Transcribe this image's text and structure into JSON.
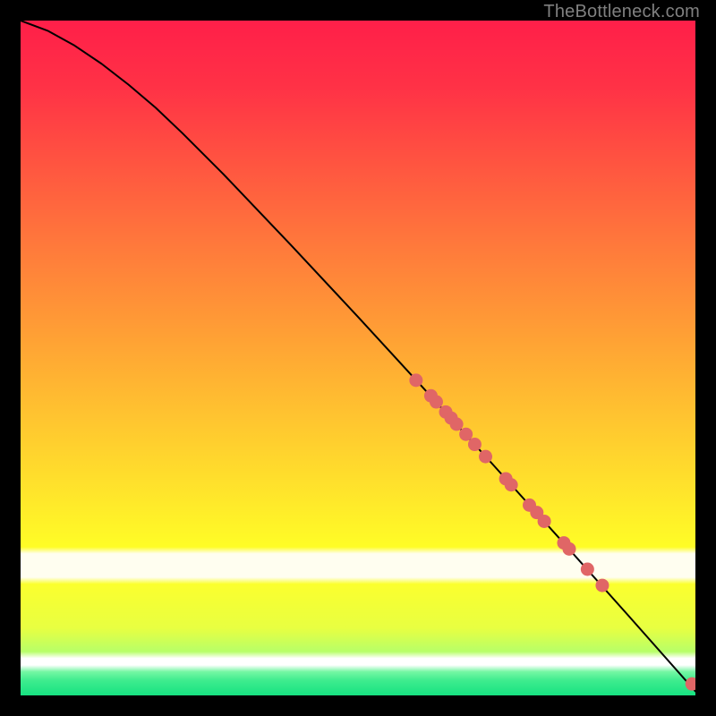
{
  "watermark": {
    "text": "TheBottleneck.com"
  },
  "chart_data": {
    "type": "line",
    "title": "",
    "xlabel": "",
    "ylabel": "",
    "xlim": [
      0,
      100
    ],
    "ylim": [
      0,
      100
    ],
    "series": [
      {
        "name": "curve",
        "x": [
          0,
          4,
          8,
          12,
          16,
          20,
          24,
          30,
          40,
          50,
          60,
          70,
          80,
          90,
          100
        ],
        "y": [
          100,
          98.5,
          96.3,
          93.6,
          90.5,
          87.1,
          83.3,
          77.3,
          66.8,
          56.1,
          45.2,
          34.2,
          23.1,
          11.9,
          0.6
        ]
      },
      {
        "name": "points",
        "x": [
          58.6,
          60.8,
          61.6,
          63.0,
          63.8,
          64.6,
          66.0,
          67.3,
          68.9,
          71.9,
          72.7,
          75.4,
          76.5,
          77.6,
          80.5,
          81.3,
          84.0,
          86.2,
          99.5
        ],
        "y": [
          46.7,
          44.4,
          43.5,
          42.0,
          41.1,
          40.2,
          38.7,
          37.2,
          35.4,
          32.1,
          31.2,
          28.2,
          27.1,
          25.8,
          22.6,
          21.7,
          18.7,
          16.3,
          1.7
        ]
      }
    ]
  }
}
